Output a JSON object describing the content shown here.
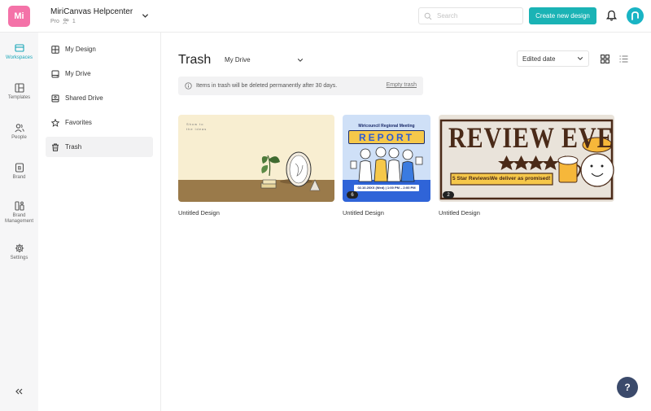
{
  "header": {
    "logo_text": "Mi",
    "team_name": "MiriCanvas Helpcenter",
    "plan": "Pro",
    "member_count": "1",
    "search_placeholder": "Search",
    "create_button": "Create new design",
    "brand_color": "#1ab3b5"
  },
  "rail": {
    "items": [
      {
        "label": "Workspaces",
        "icon": "workspaces-icon",
        "active": true
      },
      {
        "label": "Templates",
        "icon": "templates-icon"
      },
      {
        "label": "People",
        "icon": "people-icon"
      },
      {
        "label": "Brand",
        "icon": "brand-icon"
      },
      {
        "label": "Brand Management",
        "icon": "brand-management-icon"
      },
      {
        "label": "Settings",
        "icon": "settings-icon"
      }
    ]
  },
  "subnav": {
    "items": [
      {
        "label": "My Design",
        "icon": "my-design-icon"
      },
      {
        "label": "My Drive",
        "icon": "my-drive-icon"
      },
      {
        "label": "Shared Drive",
        "icon": "shared-drive-icon"
      },
      {
        "label": "Favorites",
        "icon": "star-icon"
      },
      {
        "label": "Trash",
        "icon": "trash-icon",
        "active": true
      }
    ]
  },
  "main": {
    "title": "Trash",
    "drive_filter": "My Drive",
    "sort": "Edited date",
    "notice": "Items in trash will be deleted permanently after 30 days.",
    "empty_trash": "Empty trash"
  },
  "designs": [
    {
      "title": "Untitled Design",
      "page_count": "",
      "thumb_text": [
        "Show to",
        "the ideas"
      ]
    },
    {
      "title": "Untitled Design",
      "page_count": "6",
      "thumb_text": [
        "Miricouncil Regional Meeting",
        "REPORT",
        "02.10.20XX (Wed) | 1:00 PM – 2:00 PM"
      ]
    },
    {
      "title": "Untitled Design",
      "page_count": "2",
      "thumb_text": [
        "REVIEW EVENT",
        "5 Star Reviews",
        "We deliver as promised!"
      ]
    }
  ]
}
